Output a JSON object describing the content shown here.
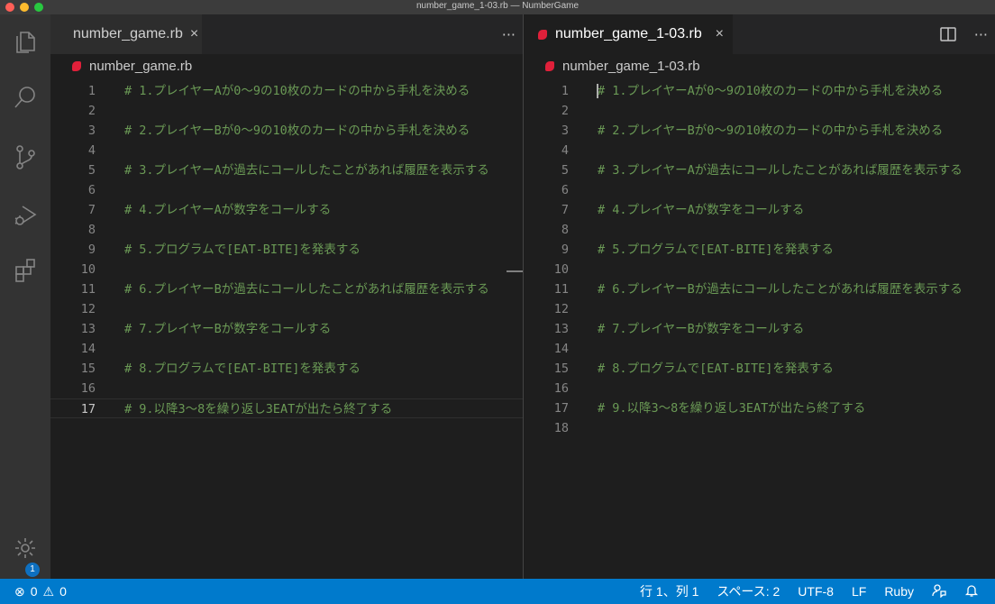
{
  "window": {
    "title": "number_game_1-03.rb — NumberGame"
  },
  "activity_bar": {
    "settings_badge": "1"
  },
  "left_group": {
    "tab_label": "number_game.rb",
    "tab_close": "×",
    "more_actions": "···",
    "breadcrumb": "number_game.rb",
    "lines": [
      {
        "n": "1",
        "text": "# 1.プレイヤーAが0〜9の10枚のカードの中から手札を決める"
      },
      {
        "n": "2",
        "text": ""
      },
      {
        "n": "3",
        "text": "# 2.プレイヤーBが0〜9の10枚のカードの中から手札を決める"
      },
      {
        "n": "4",
        "text": ""
      },
      {
        "n": "5",
        "text": "# 3.プレイヤーAが過去にコールしたことがあれば履歴を表示する"
      },
      {
        "n": "6",
        "text": ""
      },
      {
        "n": "7",
        "text": "# 4.プレイヤーAが数字をコールする"
      },
      {
        "n": "8",
        "text": ""
      },
      {
        "n": "9",
        "text": "# 5.プログラムで[EAT-BITE]を発表する"
      },
      {
        "n": "10",
        "text": ""
      },
      {
        "n": "11",
        "text": "# 6.プレイヤーBが過去にコールしたことがあれば履歴を表示する"
      },
      {
        "n": "12",
        "text": ""
      },
      {
        "n": "13",
        "text": "# 7.プレイヤーBが数字をコールする"
      },
      {
        "n": "14",
        "text": ""
      },
      {
        "n": "15",
        "text": "# 8.プログラムで[EAT-BITE]を発表する"
      },
      {
        "n": "16",
        "text": ""
      },
      {
        "n": "17",
        "text": "# 9.以降3〜8を繰り返し3EATが出たら終了する"
      }
    ]
  },
  "right_group": {
    "tab_label": "number_game_1-03.rb",
    "tab_close": "×",
    "more_actions": "···",
    "breadcrumb": "number_game_1-03.rb",
    "lines": [
      {
        "n": "1",
        "text": "# 1.プレイヤーAが0〜9の10枚のカードの中から手札を決める"
      },
      {
        "n": "2",
        "text": ""
      },
      {
        "n": "3",
        "text": "# 2.プレイヤーBが0〜9の10枚のカードの中から手札を決める"
      },
      {
        "n": "4",
        "text": ""
      },
      {
        "n": "5",
        "text": "# 3.プレイヤーAが過去にコールしたことがあれば履歴を表示する"
      },
      {
        "n": "6",
        "text": ""
      },
      {
        "n": "7",
        "text": "# 4.プレイヤーAが数字をコールする"
      },
      {
        "n": "8",
        "text": ""
      },
      {
        "n": "9",
        "text": "# 5.プログラムで[EAT-BITE]を発表する"
      },
      {
        "n": "10",
        "text": ""
      },
      {
        "n": "11",
        "text": "# 6.プレイヤーBが過去にコールしたことがあれば履歴を表示する"
      },
      {
        "n": "12",
        "text": ""
      },
      {
        "n": "13",
        "text": "# 7.プレイヤーBが数字をコールする"
      },
      {
        "n": "14",
        "text": ""
      },
      {
        "n": "15",
        "text": "# 8.プログラムで[EAT-BITE]を発表する"
      },
      {
        "n": "16",
        "text": ""
      },
      {
        "n": "17",
        "text": "# 9.以降3〜8を繰り返し3EATが出たら終了する"
      },
      {
        "n": "18",
        "text": ""
      }
    ]
  },
  "status_bar": {
    "errors": "0",
    "warnings": "0",
    "cursor_position": "行 1、列 1",
    "indentation": "スペース: 2",
    "encoding": "UTF-8",
    "line_ending": "LF",
    "language": "Ruby"
  },
  "colors": {
    "comment": "#6a9955",
    "status_bar": "#007acc",
    "activity_bar": "#333333",
    "editor_bg": "#1e1e1e",
    "ruby_icon": "#e0203a"
  }
}
